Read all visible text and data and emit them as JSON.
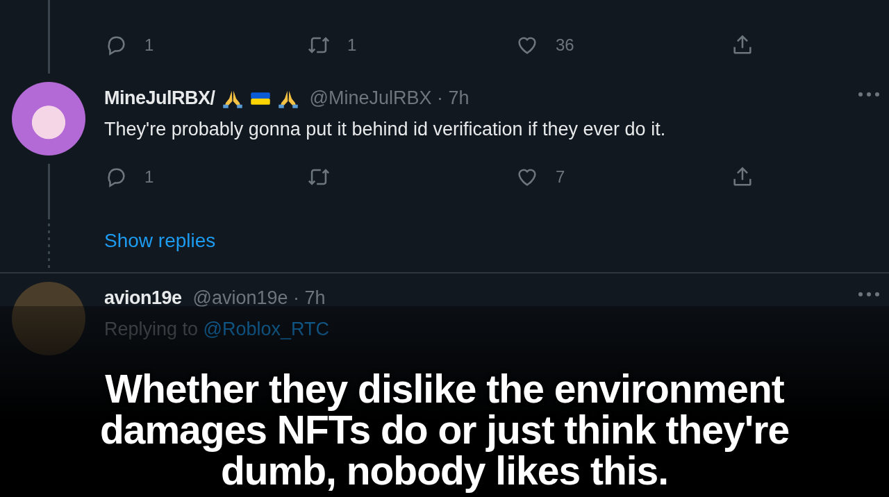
{
  "top_actions": [
    {
      "kind": "reply",
      "count": "1"
    },
    {
      "kind": "retweet",
      "count": "1"
    },
    {
      "kind": "like",
      "count": "36"
    },
    {
      "kind": "share"
    }
  ],
  "tweets": [
    {
      "display_name": "MineJulRBX/",
      "name_emoji": [
        {
          "kind": "pray"
        },
        {
          "kind": "ukraine"
        },
        {
          "kind": "pray"
        }
      ],
      "meta": "@MineJulRBX · 7h",
      "text": "They're probably gonna put it behind id verification if they ever do it.",
      "actions": [
        {
          "kind": "reply",
          "count": "1"
        },
        {
          "kind": "retweet"
        },
        {
          "kind": "like",
          "count": "7"
        },
        {
          "kind": "share"
        }
      ]
    },
    {
      "display_name": "avion19e",
      "meta": "@avion19e · 7h",
      "replying_prefix": "Replying to",
      "replying_handle": "@Roblox_RTC"
    }
  ],
  "show_replies": "Show replies",
  "caption": "Whether they dislike the environment damages NFTs do or just think they're dumb, nobody likes this."
}
